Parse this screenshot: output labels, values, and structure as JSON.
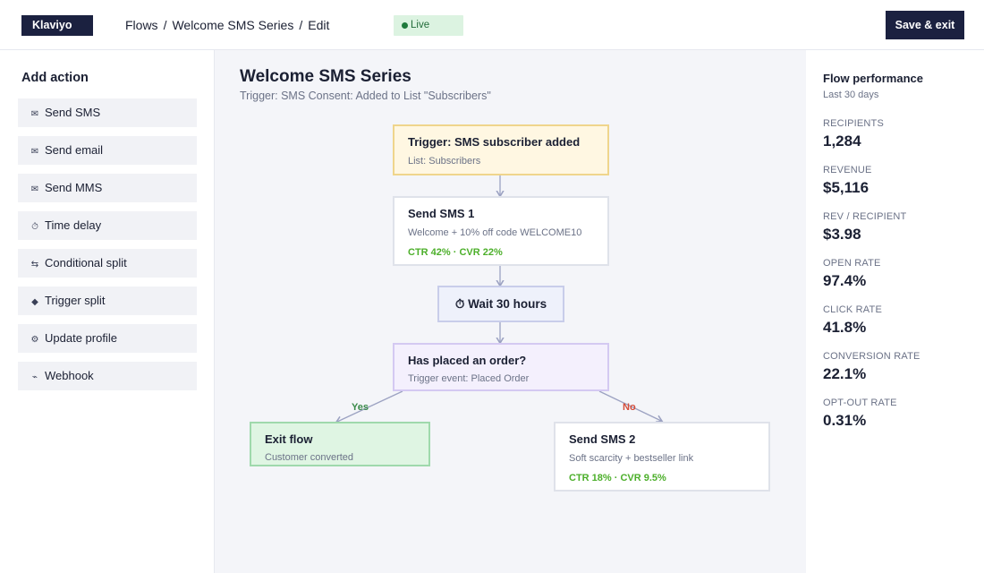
{
  "header": {
    "logo_text": "Klaviyo",
    "breadcrumb": [
      "Flows",
      "Welcome SMS Series",
      "Edit"
    ],
    "breadcrumb_separator": "/",
    "status_label": "Live",
    "save_label": "Save & exit"
  },
  "sidebar": {
    "title": "Add action",
    "actions": [
      {
        "icon": "envelope-icon",
        "glyph": "✉",
        "label": "Send SMS"
      },
      {
        "icon": "envelope-icon",
        "glyph": "✉",
        "label": "Send email"
      },
      {
        "icon": "envelope-icon",
        "glyph": "✉",
        "label": "Send MMS"
      },
      {
        "icon": "stopwatch-icon",
        "glyph": "⏱",
        "label": "Time delay"
      },
      {
        "icon": "split-arrows-icon",
        "glyph": "⇆",
        "label": "Conditional split"
      },
      {
        "icon": "diamond-icon",
        "glyph": "◆",
        "label": "Trigger split"
      },
      {
        "icon": "gear-icon",
        "glyph": "⚙",
        "label": "Update profile"
      },
      {
        "icon": "webhook-icon",
        "glyph": "⌁",
        "label": "Webhook"
      }
    ]
  },
  "canvas": {
    "title": "Welcome SMS Series",
    "trigger_line": "Trigger: SMS Consent: Added to List \"Subscribers\"",
    "nodes": {
      "trigger": {
        "title": "Trigger: SMS subscriber added",
        "subtitle": "List: Subscribers"
      },
      "sms1": {
        "title": "Send SMS 1",
        "subtitle": "Welcome + 10% off code WELCOME10",
        "stats": "CTR 42%  ·  CVR 22%"
      },
      "wait": {
        "icon": "stopwatch-icon",
        "title": "⏱ Wait 30 hours"
      },
      "split": {
        "title": "Has placed an order?",
        "subtitle": "Trigger event: Placed Order"
      },
      "exit": {
        "title": "Exit flow",
        "subtitle": "Customer converted"
      },
      "sms2": {
        "title": "Send SMS 2",
        "subtitle": "Soft scarcity + bestseller link",
        "stats": "CTR 18%  ·  CVR 9.5%"
      }
    },
    "branches": {
      "yes": "Yes",
      "no": "No"
    }
  },
  "performance": {
    "title": "Flow performance",
    "period": "Last 30 days",
    "metrics": [
      {
        "label": "RECIPIENTS",
        "value": "1,284"
      },
      {
        "label": "REVENUE",
        "value": "$5,116"
      },
      {
        "label": "REV / RECIPIENT",
        "value": "$3.98"
      },
      {
        "label": "OPEN RATE",
        "value": "97.4%"
      },
      {
        "label": "CLICK RATE",
        "value": "41.8%"
      },
      {
        "label": "CONVERSION RATE",
        "value": "22.1%"
      },
      {
        "label": "OPT-OUT RATE",
        "value": "0.31%"
      }
    ]
  },
  "colors": {
    "navy": "#1b2140",
    "live_bg": "#dcf3e1",
    "live_text": "#226c3a",
    "trigger_bg": "#fff7e2",
    "split_bg": "#f4f0fd",
    "exit_bg": "#dff5e3",
    "stat_green": "#4caf2a",
    "yes_green": "#3a8a4a",
    "no_red": "#d54d3a"
  }
}
